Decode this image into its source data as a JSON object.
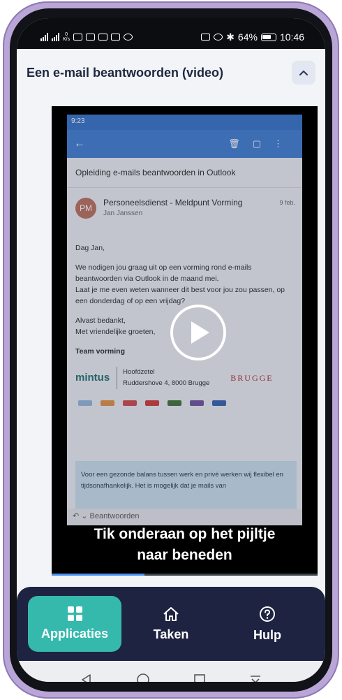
{
  "status_bar": {
    "speed_value": "0",
    "speed_unit": "K/s",
    "battery": "64%",
    "time": "10:46"
  },
  "card": {
    "title": "Een e-mail beantwoorden (video)"
  },
  "video": {
    "phone_time": "9:23",
    "email_subject": "Opleiding e-mails beantwoorden in Outlook",
    "avatar_initials": "PM",
    "sender_name": "Personeelsdienst - Meldpunt Vorming",
    "sender_to": "Jan Janssen",
    "date": "9 feb.",
    "greeting": "Dag Jan,",
    "paragraph1": "We nodigen jou graag uit op een vorming rond e-mails beantwoorden via Outlook in de maand mei.",
    "paragraph2": "Laat je me even weten wanneer dit best voor jou zou passen, op een donderdag of op een vrijdag?",
    "closing1": "Alvast bedankt,",
    "closing2": "Met vriendelijke groeten,",
    "team": "Team vorming",
    "logo_text": "mintus",
    "address1": "Hoofdzetel",
    "address2": "Ruddershove 4, 8000 Brugge",
    "city_logo": "BRUGGE",
    "note": "Voor een gezonde balans tussen werk en privé werken wij flexibel en tijdsonafhankelijk. Het is mogelijk dat je mails van",
    "reply_label": "Beantwoorden",
    "caption_line1": "Tik onderaan op het pijltje",
    "caption_line2": "naar beneden",
    "progress": 0.35
  },
  "bottom_nav": {
    "items": [
      {
        "label": "Applicaties",
        "icon": "grid-icon",
        "active": true
      },
      {
        "label": "Taken",
        "icon": "home-icon",
        "active": false
      },
      {
        "label": "Hulp",
        "icon": "help-icon",
        "active": false
      }
    ]
  },
  "colors": {
    "accent": "#35b9ad",
    "nav_background": "#1d2341",
    "title": "#1d2740"
  }
}
